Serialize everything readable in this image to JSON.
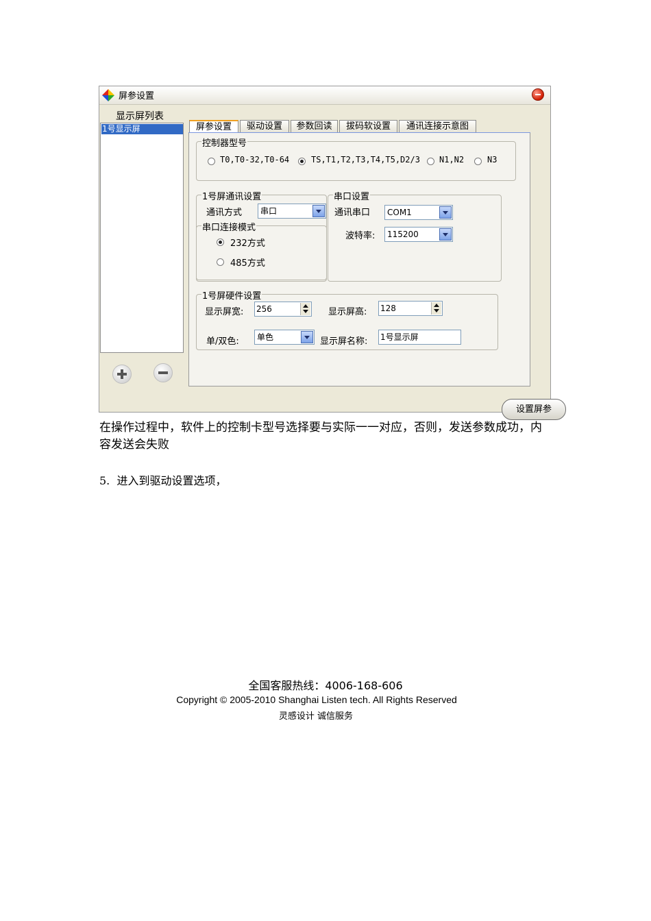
{
  "window": {
    "title": "屏参设置",
    "list_label": "显示屏列表",
    "list_items": [
      "1号显示屏"
    ],
    "tabs": [
      "屏参设置",
      "驱动设置",
      "参数回读",
      "拔码软设置",
      "通讯连接示意图"
    ],
    "active_tab": "屏参设置",
    "controller_group": {
      "title": "控制器型号",
      "options": [
        "T0,T0-32,T0-64",
        "TS,T1,T2,T3,T4,T5,D2/3",
        "N1,N2",
        "N3"
      ],
      "selected": "TS,T1,T2,T3,T4,T5,D2/3"
    },
    "comm_group": {
      "title": "1号屏通讯设置",
      "method_label": "通讯方式",
      "method_value": "串口"
    },
    "serial_mode_group": {
      "title": "串口连接模式",
      "options": [
        "232方式",
        "485方式"
      ],
      "selected": "232方式"
    },
    "serial_group": {
      "title": "串口设置",
      "port_label": "通讯串口",
      "port_value": "COM1",
      "baud_label": "波特率:",
      "baud_value": "115200"
    },
    "hardware_group": {
      "title": "1号屏硬件设置",
      "width_label": "显示屏宽:",
      "width_value": "256",
      "height_label": "显示屏高:",
      "height_value": "128",
      "color_label": "单/双色:",
      "color_value": "单色",
      "name_label": "显示屏名称:",
      "name_value": "1号显示屏"
    },
    "set_button": "设置屏参"
  },
  "document": {
    "paragraph": "在操作过程中，软件上的控制卡型号选择要与实际一一对应，否则，发送参数成功，内容发送会失败",
    "step_number": "5.",
    "step_text": "进入到驱动设置选项，",
    "hotline": "全国客服热线：4006-168-606",
    "copyright": "Copyright © 2005-2010 Shanghai Listen tech. All Rights Reserved",
    "slogan": "灵感设计  诚信服务"
  }
}
